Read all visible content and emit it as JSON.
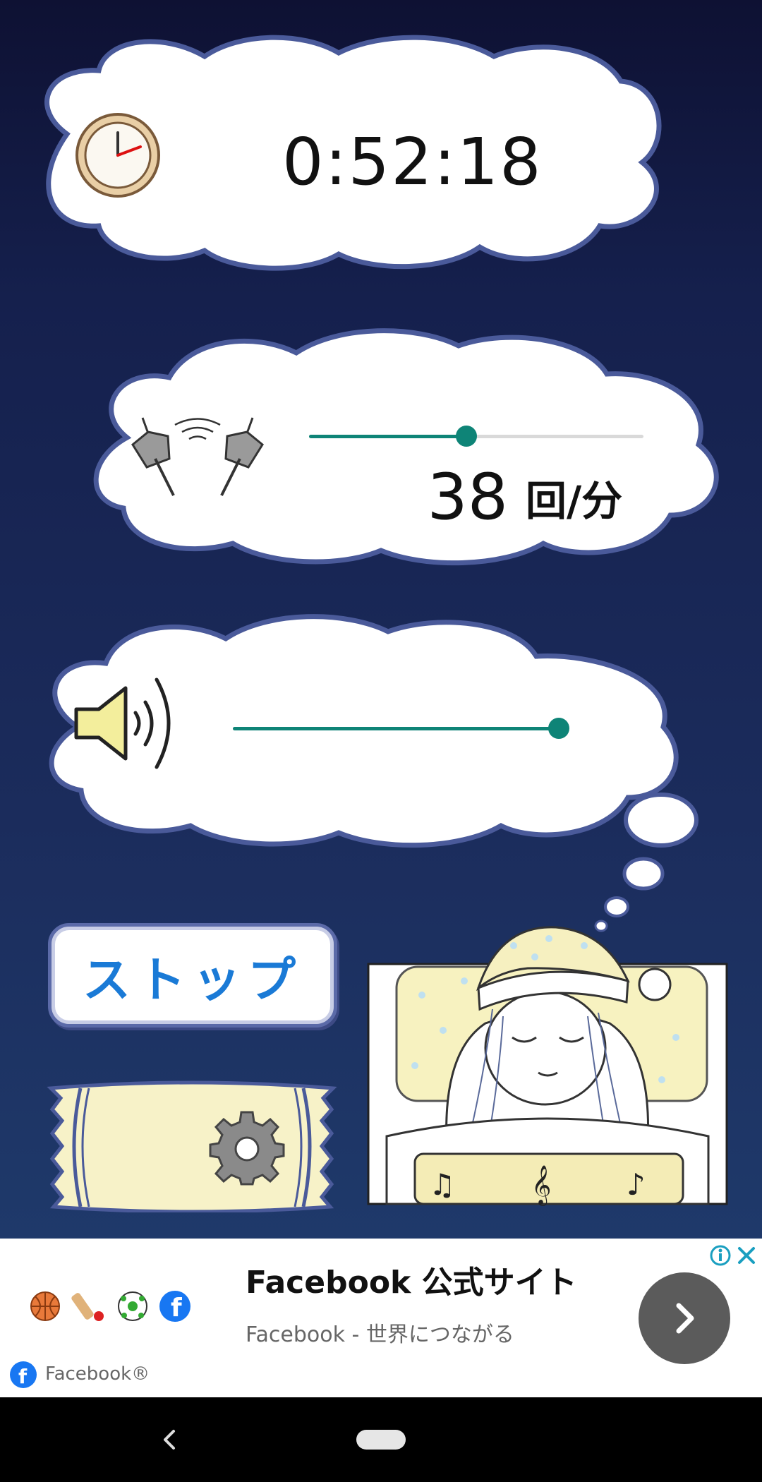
{
  "timer": {
    "elapsed": "0:52:18"
  },
  "rate": {
    "value": "38",
    "unit": "回/分",
    "level": 0.47
  },
  "volume": {
    "level": 1.0
  },
  "controls": {
    "stop_label": "ストップ"
  },
  "icons": {
    "clock": "clock-icon",
    "clicker": "clicker-icon",
    "speaker": "speaker-icon",
    "settings": "gear-icon",
    "sleeping_girl": "sleeping-girl-illustration"
  },
  "ad": {
    "title": "Facebook 公式サイト",
    "subtitle": "Facebook - 世界につながる",
    "brand": "Facebook®"
  },
  "colors": {
    "accent": "#0e8477",
    "button_text": "#1a7ad6",
    "cloud_border": "#4a5a9a"
  }
}
